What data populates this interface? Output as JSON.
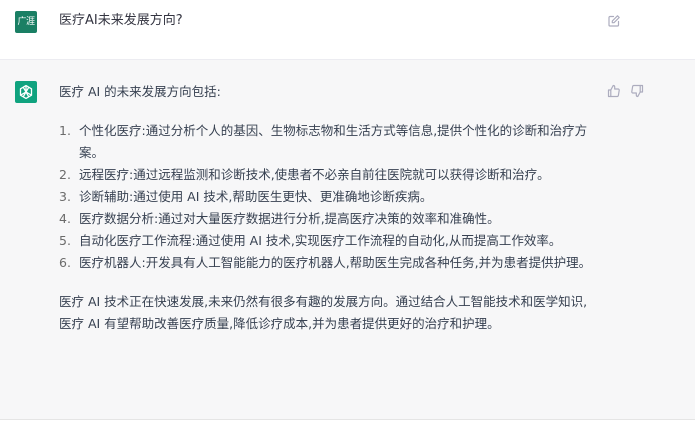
{
  "user": {
    "avatar_label": "广涯",
    "question": "医疗AI未来发展方向?"
  },
  "assistant": {
    "intro": "医疗 AI 的未来发展方向包括:",
    "items": [
      {
        "number": "1.",
        "text": "个性化医疗:通过分析个人的基因、生物标志物和生活方式等信息,提供个性化的诊断和治疗方案。"
      },
      {
        "number": "2.",
        "text": "远程医疗:通过远程监测和诊断技术,使患者不必亲自前往医院就可以获得诊断和治疗。"
      },
      {
        "number": "3.",
        "text": "诊断辅助:通过使用 AI 技术,帮助医生更快、更准确地诊断疾病。"
      },
      {
        "number": "4.",
        "text": "医疗数据分析:通过对大量医疗数据进行分析,提高医疗决策的效率和准确性。"
      },
      {
        "number": "5.",
        "text": "自动化医疗工作流程:通过使用 AI 技术,实现医疗工作流程的自动化,从而提高工作效率。"
      },
      {
        "number": "6.",
        "text": "医疗机器人:开发具有人工智能能力的医疗机器人,帮助医生完成各种任务,并为患者提供护理。"
      }
    ],
    "summary": "医疗 AI 技术正在快速发展,未来仍然有很多有趣的发展方向。通过结合人工智能技术和医学知识,医疗 AI 有望帮助改善医疗质量,降低诊疗成本,并为患者提供更好的治疗和护理。"
  },
  "icons": {
    "edit": "edit-icon",
    "thumbs_up": "thumbs-up-icon",
    "thumbs_down": "thumbs-down-icon",
    "bot_logo": "openai-logo-icon"
  },
  "colors": {
    "user_avatar": "#1a7f64",
    "bot_avatar": "#10a37f",
    "assistant_bg": "#f7f7f8",
    "text": "#374151"
  }
}
